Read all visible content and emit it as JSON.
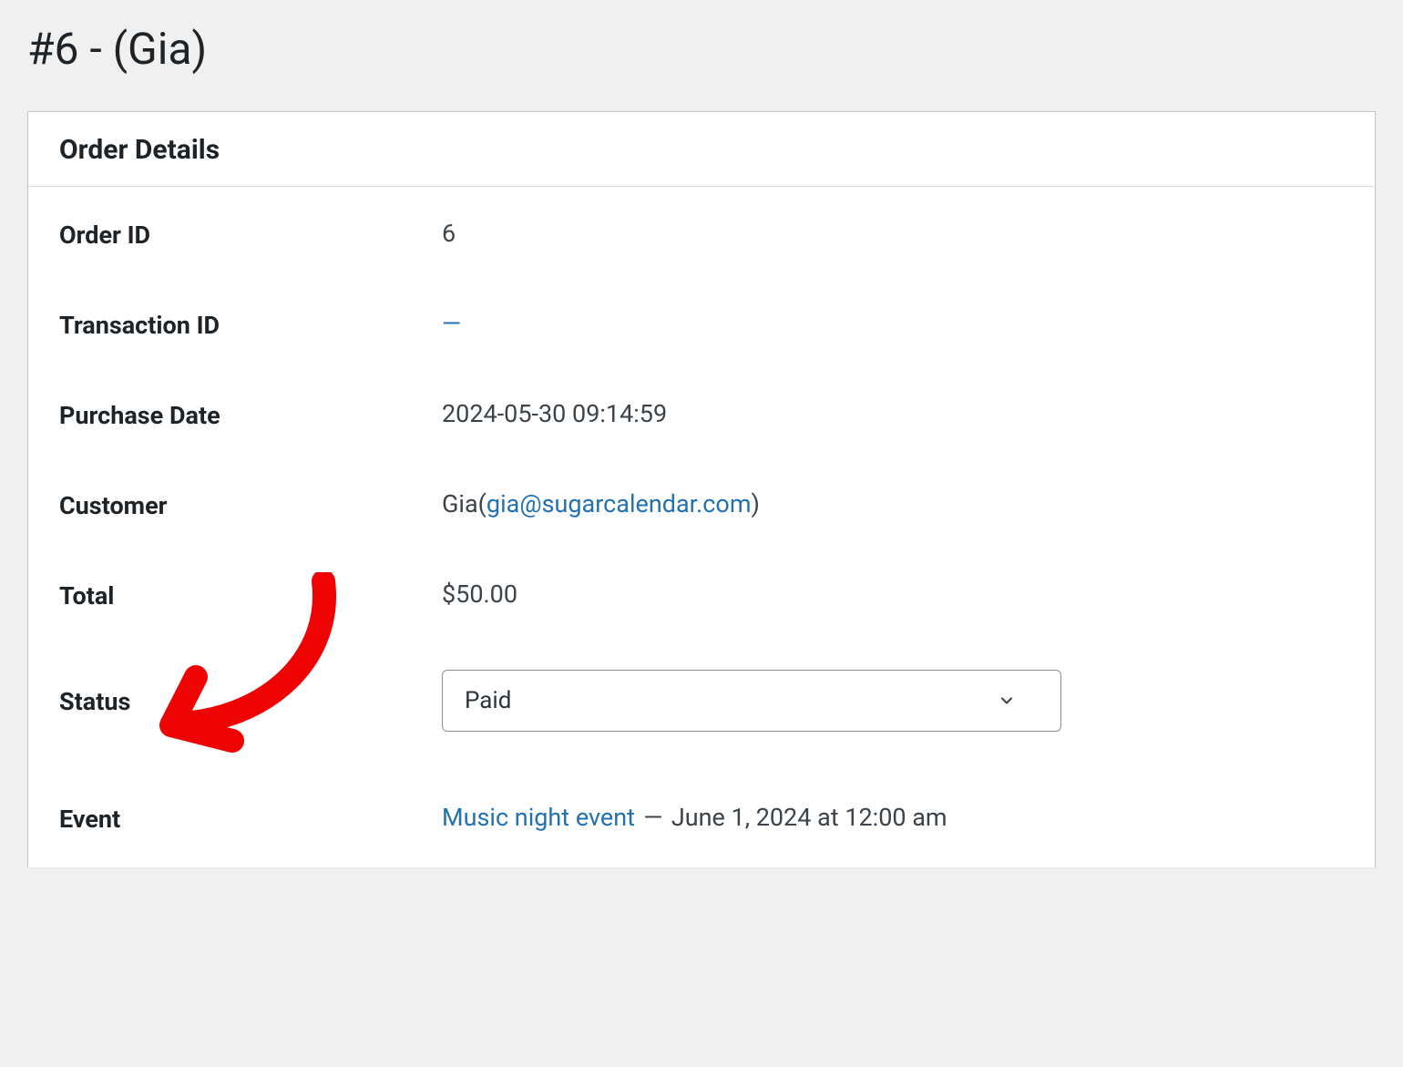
{
  "page_title": "#6 - (Gia)",
  "panel_heading": "Order Details",
  "fields": {
    "order_id": {
      "label": "Order ID",
      "value": "6"
    },
    "transaction_id": {
      "label": "Transaction ID",
      "value": "—"
    },
    "purchase_date": {
      "label": "Purchase Date",
      "value": "2024-05-30 09:14:59"
    },
    "customer": {
      "label": "Customer",
      "name": "Gia",
      "email": "gia@sugarcalendar.com"
    },
    "total": {
      "label": "Total",
      "value": "$50.00"
    },
    "status": {
      "label": "Status",
      "value": "Paid"
    },
    "event": {
      "label": "Event",
      "name": "Music night event",
      "separator": " — ",
      "date": "June 1, 2024 at 12:00 am"
    }
  }
}
